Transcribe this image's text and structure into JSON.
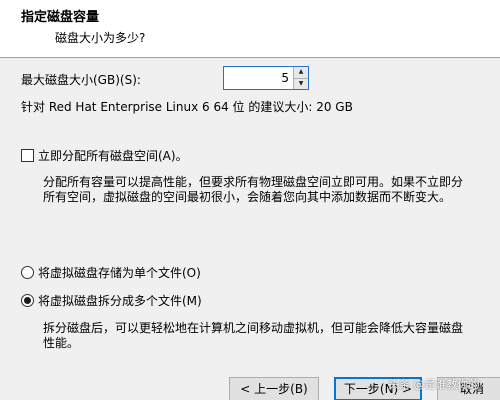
{
  "header": {
    "title": "指定磁盘容量",
    "subtitle": "磁盘大小为多少?"
  },
  "disk_size": {
    "label": "最大磁盘大小(GB)(S):",
    "value": "5",
    "recommendation": "针对 Red Hat Enterprise Linux 6 64 位 的建议大小: 20 GB"
  },
  "allocate": {
    "label": "立即分配所有磁盘空间(A)。",
    "checked": false,
    "description_line1": "分配所有容量可以提高性能，但要求所有物理磁盘空间立即可用。如果不立即分",
    "description_line2": "所有空间，虚拟磁盘的空间最初很小，会随着您向其中添加数据而不断变大。"
  },
  "storage_options": {
    "single_label": "将虚拟磁盘存储为单个文件(O)",
    "multiple_label": "将虚拟磁盘拆分成多个文件(M)",
    "selected": "multiple",
    "multiple_description_line1": "拆分磁盘后，可以更轻松地在计算机之间移动虚拟机，但可能会降低大容量磁盘",
    "multiple_description_line2": "性能。"
  },
  "footer": {
    "prev_label": "< 上一步(B)",
    "next_label": "下一步(N) >",
    "cancel_label": "取消"
  },
  "watermark": "头条 @是谁教你的",
  "colors": {
    "focus_border": "#0078d7",
    "dialog_bg": "#f0f0f0",
    "header_bg": "#ffffff"
  }
}
